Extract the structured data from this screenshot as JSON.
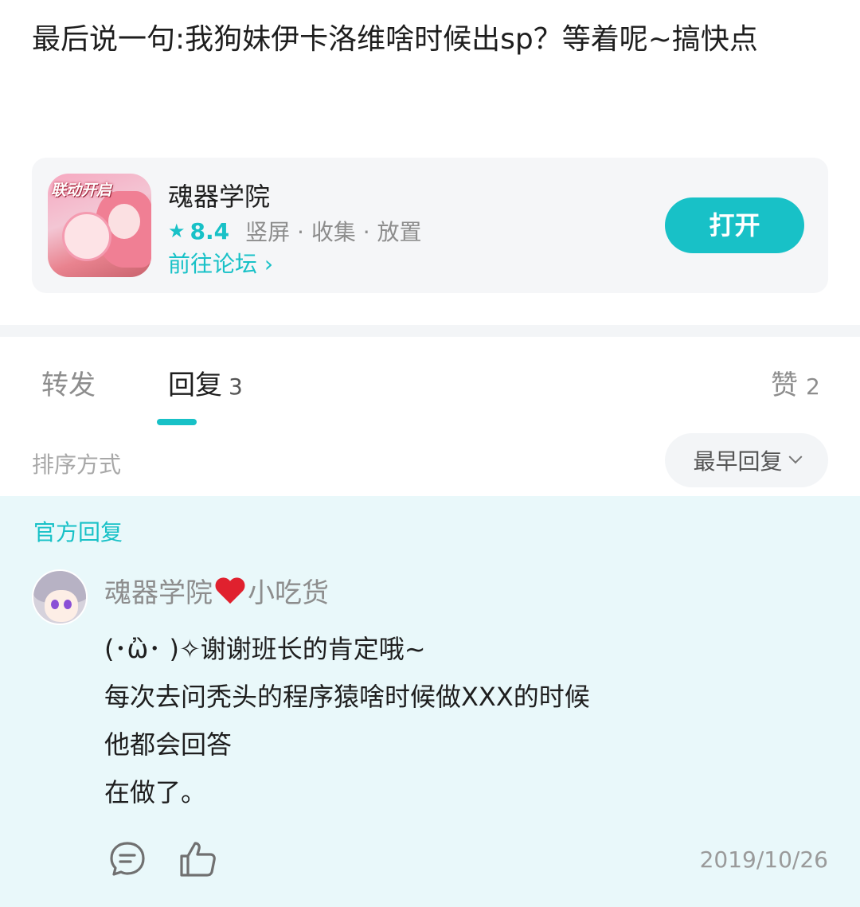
{
  "post": {
    "text": "最后说一句:我狗妹伊卡洛维啥时候出sp？等着呢~搞快点"
  },
  "game_card": {
    "icon_badge": "联动开启",
    "name": "魂器学院",
    "rating": "8.4",
    "tags": "竖屏 · 收集 · 放置",
    "forum_link": "前往论坛",
    "forum_chevron": "›",
    "open_button": "打开",
    "accent_color": "#18c1c7"
  },
  "tabs": {
    "forward": {
      "label": "转发"
    },
    "reply": {
      "label": "回复",
      "count": "3"
    },
    "like": {
      "label": "赞",
      "count": "2"
    }
  },
  "sort": {
    "label": "排序方式",
    "selected": "最早回复"
  },
  "official_reply": {
    "section_label": "官方回复",
    "author_prefix": "魂器学院",
    "author_suffix": "小吃货",
    "lines": [
      "(･ὢ･ )✧谢谢班长的肯定哦~",
      "每次去问秃头的程序猿啥时候做XXX的时候",
      "他都会回答",
      "在做了。"
    ],
    "date": "2019/10/26",
    "icons": {
      "comment": "comment-icon",
      "like": "thumbs-up-icon"
    }
  }
}
